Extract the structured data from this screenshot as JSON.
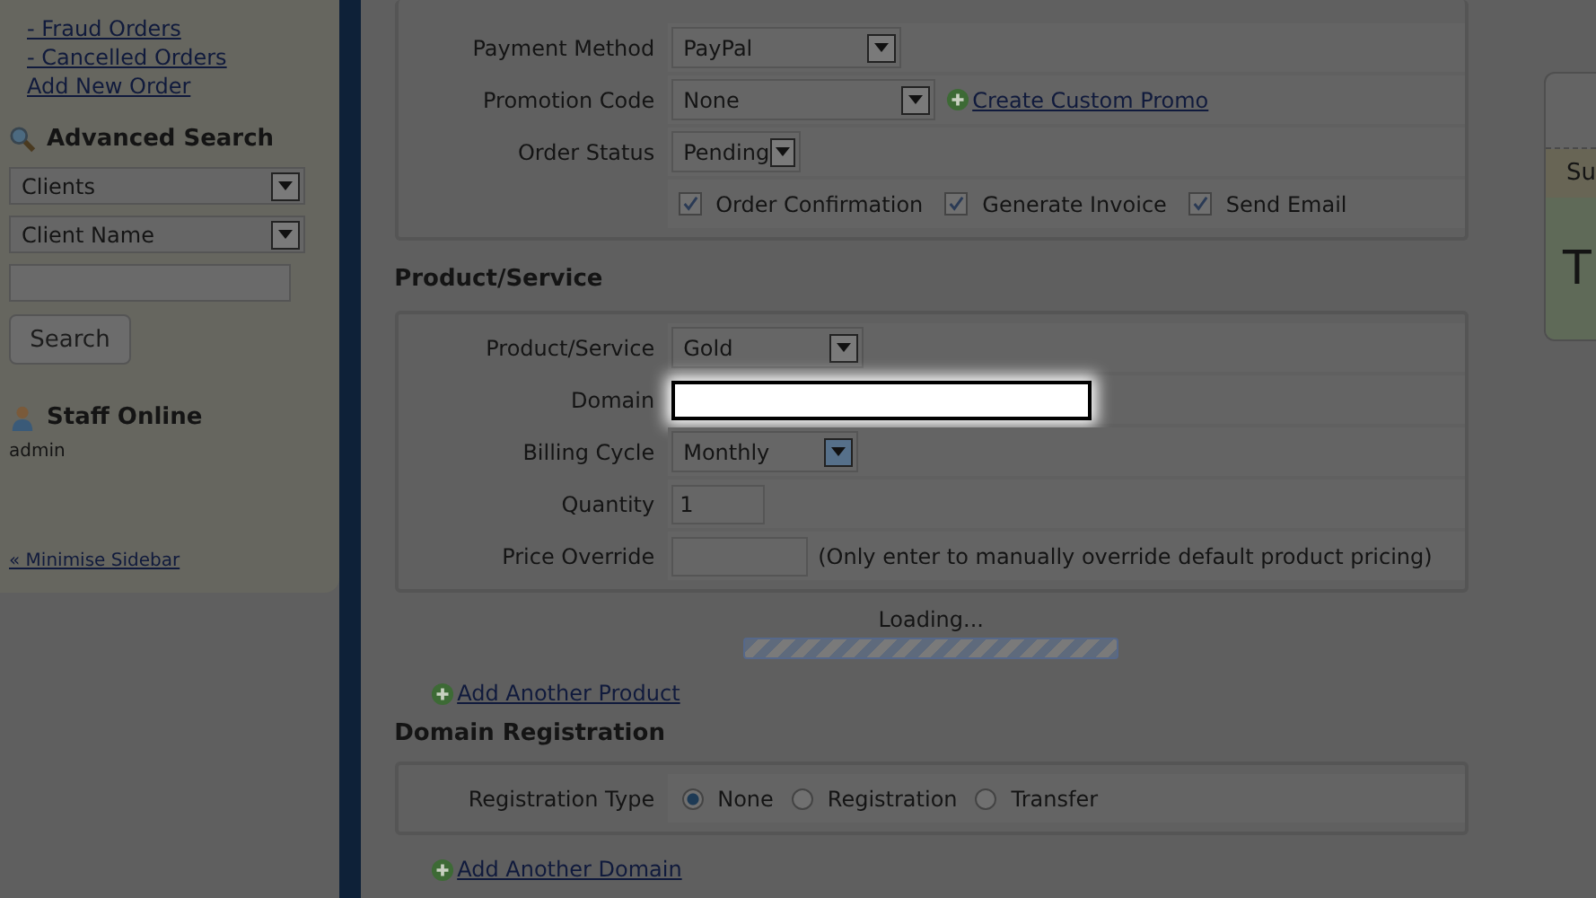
{
  "sidebar": {
    "order_links": [
      "- Fraud Orders",
      "- Cancelled Orders",
      "Add New Order"
    ],
    "advanced_search": {
      "title": "Advanced Search",
      "selects": [
        "Clients",
        "Client Name"
      ],
      "button": "Search"
    },
    "staff_online": {
      "title": "Staff Online",
      "users": [
        "admin"
      ]
    },
    "minimise_link": "« Minimise Sidebar"
  },
  "order_form": {
    "rows": [
      {
        "label": "Payment Method",
        "kind": "select",
        "value": "PayPal"
      },
      {
        "label": "Promotion Code",
        "kind": "select",
        "value": "None",
        "link": "Create Custom Promo"
      },
      {
        "label": "Order Status",
        "kind": "select",
        "value": "Pending"
      }
    ],
    "options": [
      {
        "label": "Order Confirmation",
        "checked": true
      },
      {
        "label": "Generate Invoice",
        "checked": true
      },
      {
        "label": "Send Email",
        "checked": true
      }
    ]
  },
  "product_section": {
    "title": "Product/Service",
    "rows": [
      {
        "label": "Product/Service",
        "kind": "select",
        "value": "Gold"
      },
      {
        "label": "Domain",
        "kind": "input",
        "highlighted": true
      },
      {
        "label": "Billing Cycle",
        "kind": "select",
        "value": "Monthly"
      },
      {
        "label": "Quantity",
        "kind": "input",
        "value": "1"
      },
      {
        "label": "Price Override",
        "kind": "input",
        "note": "(Only enter to manually override default product pricing)"
      }
    ]
  },
  "loading": {
    "text": "Loading..."
  },
  "add_product_link": "Add Another Product",
  "domain_section": {
    "title": "Domain Registration",
    "label": "Registration Type",
    "options": [
      {
        "label": "None",
        "selected": true
      },
      {
        "label": "Registration",
        "selected": false
      },
      {
        "label": "Transfer",
        "selected": false
      }
    ]
  },
  "add_domain_link": "Add Another Domain",
  "side_card": {
    "tab": "Su",
    "heading": "T"
  }
}
